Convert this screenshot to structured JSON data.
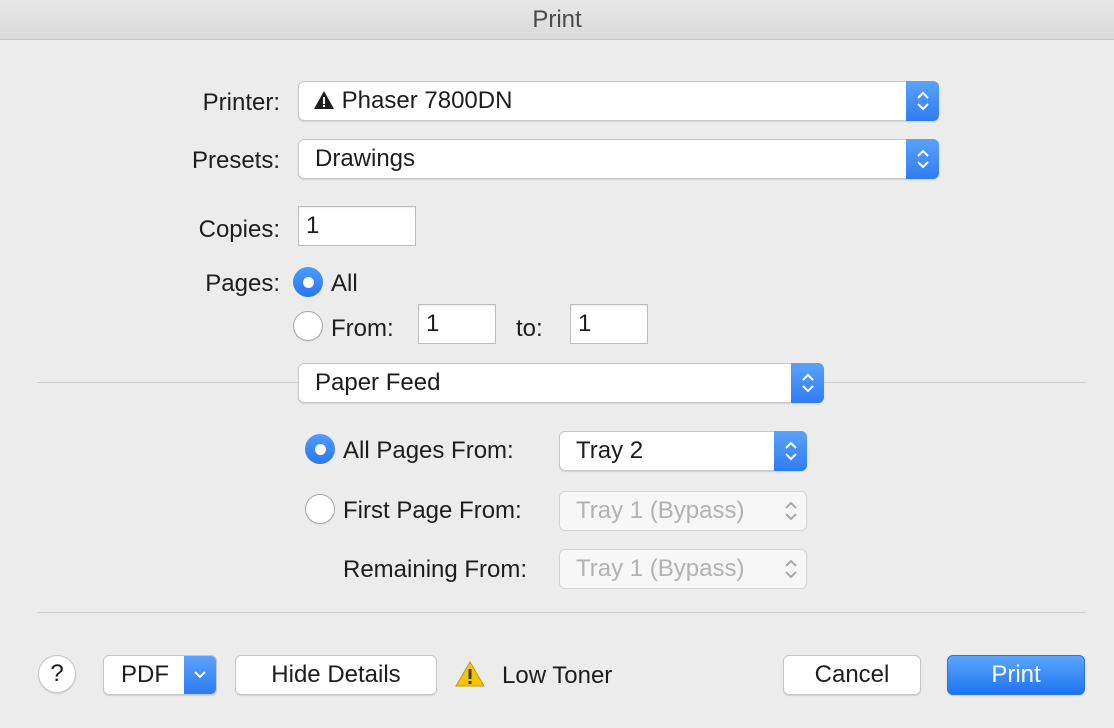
{
  "window": {
    "title": "Print"
  },
  "printer": {
    "label": "Printer:",
    "value": "Phaser 7800DN",
    "icon": "warning-icon"
  },
  "presets": {
    "label": "Presets:",
    "value": "Drawings"
  },
  "copies": {
    "label": "Copies:",
    "value": "1"
  },
  "pages": {
    "label": "Pages:",
    "all_label": "All",
    "from_label": "From:",
    "from_value": "1",
    "to_label": "to:",
    "to_value": "1",
    "selected": "All"
  },
  "section": {
    "value": "Paper Feed"
  },
  "paper_feed": {
    "all_pages_label": "All Pages From:",
    "all_pages_value": "Tray 2",
    "first_page_label": "First Page From:",
    "first_page_value": "Tray 1 (Bypass)",
    "remaining_label": "Remaining From:",
    "remaining_value": "Tray 1 (Bypass)",
    "selected": "All Pages From"
  },
  "footer": {
    "help_label": "?",
    "pdf_label": "PDF",
    "hide_details_label": "Hide Details",
    "status_text": "Low Toner",
    "status_icon": "warning-icon",
    "cancel_label": "Cancel",
    "print_label": "Print"
  },
  "colors": {
    "accent": "#2f7cf1",
    "warning": "#f5c400"
  }
}
